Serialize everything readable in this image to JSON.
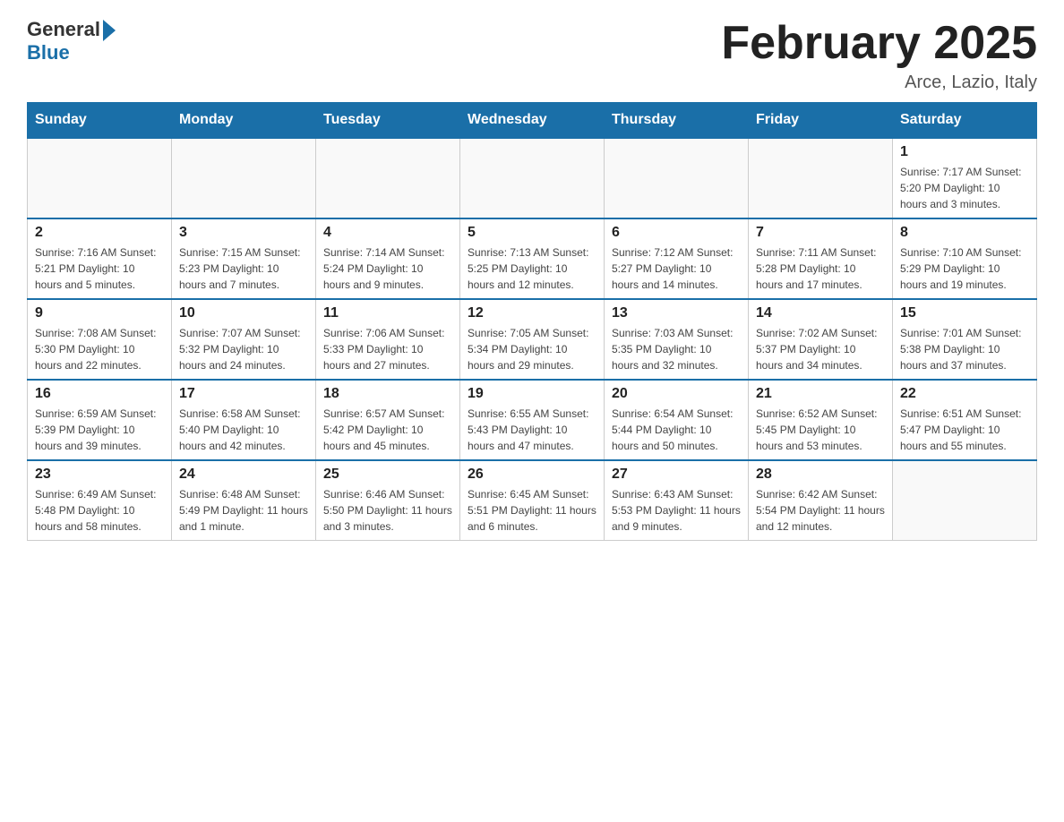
{
  "header": {
    "logo": {
      "general": "General",
      "blue": "Blue"
    },
    "title": "February 2025",
    "location": "Arce, Lazio, Italy"
  },
  "days_of_week": [
    "Sunday",
    "Monday",
    "Tuesday",
    "Wednesday",
    "Thursday",
    "Friday",
    "Saturday"
  ],
  "weeks": [
    {
      "days": [
        {
          "number": "",
          "info": ""
        },
        {
          "number": "",
          "info": ""
        },
        {
          "number": "",
          "info": ""
        },
        {
          "number": "",
          "info": ""
        },
        {
          "number": "",
          "info": ""
        },
        {
          "number": "",
          "info": ""
        },
        {
          "number": "1",
          "info": "Sunrise: 7:17 AM\nSunset: 5:20 PM\nDaylight: 10 hours and 3 minutes."
        }
      ]
    },
    {
      "days": [
        {
          "number": "2",
          "info": "Sunrise: 7:16 AM\nSunset: 5:21 PM\nDaylight: 10 hours and 5 minutes."
        },
        {
          "number": "3",
          "info": "Sunrise: 7:15 AM\nSunset: 5:23 PM\nDaylight: 10 hours and 7 minutes."
        },
        {
          "number": "4",
          "info": "Sunrise: 7:14 AM\nSunset: 5:24 PM\nDaylight: 10 hours and 9 minutes."
        },
        {
          "number": "5",
          "info": "Sunrise: 7:13 AM\nSunset: 5:25 PM\nDaylight: 10 hours and 12 minutes."
        },
        {
          "number": "6",
          "info": "Sunrise: 7:12 AM\nSunset: 5:27 PM\nDaylight: 10 hours and 14 minutes."
        },
        {
          "number": "7",
          "info": "Sunrise: 7:11 AM\nSunset: 5:28 PM\nDaylight: 10 hours and 17 minutes."
        },
        {
          "number": "8",
          "info": "Sunrise: 7:10 AM\nSunset: 5:29 PM\nDaylight: 10 hours and 19 minutes."
        }
      ]
    },
    {
      "days": [
        {
          "number": "9",
          "info": "Sunrise: 7:08 AM\nSunset: 5:30 PM\nDaylight: 10 hours and 22 minutes."
        },
        {
          "number": "10",
          "info": "Sunrise: 7:07 AM\nSunset: 5:32 PM\nDaylight: 10 hours and 24 minutes."
        },
        {
          "number": "11",
          "info": "Sunrise: 7:06 AM\nSunset: 5:33 PM\nDaylight: 10 hours and 27 minutes."
        },
        {
          "number": "12",
          "info": "Sunrise: 7:05 AM\nSunset: 5:34 PM\nDaylight: 10 hours and 29 minutes."
        },
        {
          "number": "13",
          "info": "Sunrise: 7:03 AM\nSunset: 5:35 PM\nDaylight: 10 hours and 32 minutes."
        },
        {
          "number": "14",
          "info": "Sunrise: 7:02 AM\nSunset: 5:37 PM\nDaylight: 10 hours and 34 minutes."
        },
        {
          "number": "15",
          "info": "Sunrise: 7:01 AM\nSunset: 5:38 PM\nDaylight: 10 hours and 37 minutes."
        }
      ]
    },
    {
      "days": [
        {
          "number": "16",
          "info": "Sunrise: 6:59 AM\nSunset: 5:39 PM\nDaylight: 10 hours and 39 minutes."
        },
        {
          "number": "17",
          "info": "Sunrise: 6:58 AM\nSunset: 5:40 PM\nDaylight: 10 hours and 42 minutes."
        },
        {
          "number": "18",
          "info": "Sunrise: 6:57 AM\nSunset: 5:42 PM\nDaylight: 10 hours and 45 minutes."
        },
        {
          "number": "19",
          "info": "Sunrise: 6:55 AM\nSunset: 5:43 PM\nDaylight: 10 hours and 47 minutes."
        },
        {
          "number": "20",
          "info": "Sunrise: 6:54 AM\nSunset: 5:44 PM\nDaylight: 10 hours and 50 minutes."
        },
        {
          "number": "21",
          "info": "Sunrise: 6:52 AM\nSunset: 5:45 PM\nDaylight: 10 hours and 53 minutes."
        },
        {
          "number": "22",
          "info": "Sunrise: 6:51 AM\nSunset: 5:47 PM\nDaylight: 10 hours and 55 minutes."
        }
      ]
    },
    {
      "days": [
        {
          "number": "23",
          "info": "Sunrise: 6:49 AM\nSunset: 5:48 PM\nDaylight: 10 hours and 58 minutes."
        },
        {
          "number": "24",
          "info": "Sunrise: 6:48 AM\nSunset: 5:49 PM\nDaylight: 11 hours and 1 minute."
        },
        {
          "number": "25",
          "info": "Sunrise: 6:46 AM\nSunset: 5:50 PM\nDaylight: 11 hours and 3 minutes."
        },
        {
          "number": "26",
          "info": "Sunrise: 6:45 AM\nSunset: 5:51 PM\nDaylight: 11 hours and 6 minutes."
        },
        {
          "number": "27",
          "info": "Sunrise: 6:43 AM\nSunset: 5:53 PM\nDaylight: 11 hours and 9 minutes."
        },
        {
          "number": "28",
          "info": "Sunrise: 6:42 AM\nSunset: 5:54 PM\nDaylight: 11 hours and 12 minutes."
        },
        {
          "number": "",
          "info": ""
        }
      ]
    }
  ]
}
